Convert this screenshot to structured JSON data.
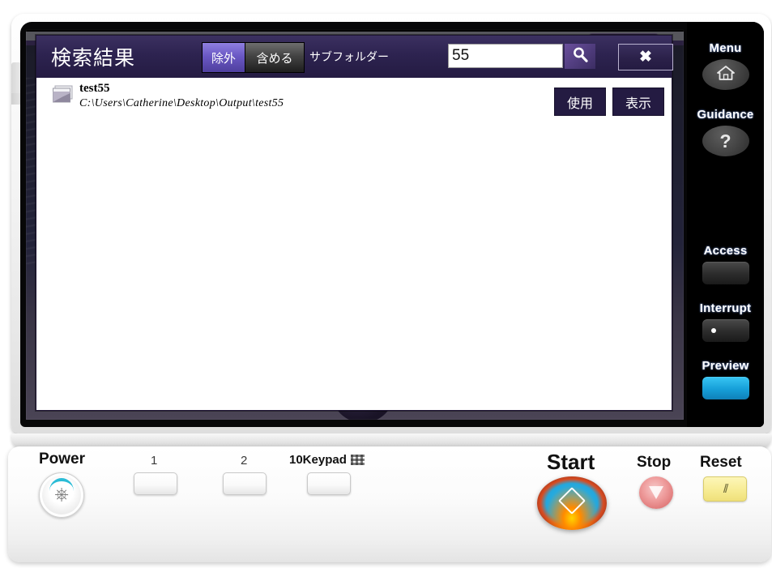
{
  "dialog": {
    "title": "検索結果",
    "segmented": {
      "exclude_label": "除外",
      "include_label": "含める",
      "selected": "除外"
    },
    "subfolder_label": "サブフォルダー",
    "search": {
      "value": "55",
      "placeholder": "",
      "search_icon": "search-icon",
      "search_button_label": ""
    },
    "close_label": "✖",
    "results": [
      {
        "icon": "folder-icon",
        "name": "test55",
        "path": "C:\\Users\\Catherine\\Desktop\\Output\\test55",
        "use_label": "使用",
        "show_label": "表示"
      }
    ]
  },
  "hardkeys": [
    {
      "label": "Menu",
      "icon": "home-icon",
      "shape": "round"
    },
    {
      "label": "Guidance",
      "icon": "question-mark-icon",
      "shape": "round"
    },
    {
      "label": "Access",
      "icon": "",
      "shape": "rect"
    },
    {
      "label": "Interrupt",
      "icon": "dot-icon",
      "shape": "rect"
    },
    {
      "label": "Preview",
      "icon": "",
      "shape": "rect-preview"
    }
  ],
  "control_panel": {
    "power_label": "Power",
    "button_1_label": "1",
    "button_2_label": "2",
    "keypad_label": "10Keypad",
    "keypad_icon": "keypad-grid-icon",
    "start_label": "Start",
    "stop_label": "Stop",
    "reset_label": "Reset",
    "reset_glyph": "//",
    "power_icon": "power-symbol-icon"
  },
  "colors": {
    "dialog_titlebar": "#2d2350",
    "accent_purple": "#4f3f9e",
    "button_dark": "#241b42",
    "preview_blue": "#169fd8",
    "start_blue": "#24a7dc",
    "stop_red": "#e07a7a",
    "reset_yellow": "#f7ec94"
  }
}
